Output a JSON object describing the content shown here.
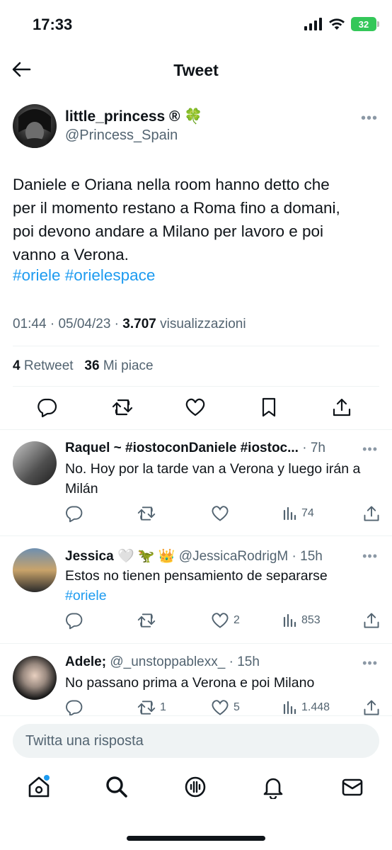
{
  "status_bar": {
    "time": "17:33",
    "battery": "32"
  },
  "header": {
    "title": "Tweet"
  },
  "tweet": {
    "author_name": "little_princess ®",
    "author_emoji": "🍀",
    "handle": "@Princess_Spain",
    "more": "•••",
    "text_lines": [
      "Daniele e Oriana nella room hanno detto che",
      "per il momento restano a Roma fino a domani,",
      "poi devono andare a Milano per lavoro e poi",
      "vanno a Verona."
    ],
    "hashtags": "#oriele #orielespace",
    "time": "01:44",
    "date": "05/04/23",
    "views_count": "3.707",
    "views_label": "visualizzazioni",
    "retweets_count": "4",
    "retweets_label": "Retweet",
    "likes_count": "36",
    "likes_label": "Mi piace"
  },
  "replies": [
    {
      "name": "Raquel ~ #iostoconDaniele #iostoc...",
      "handle": "",
      "age": "7h",
      "text": "No. Hoy por la tarde van a Verona y luego irán a Milán",
      "hashtag": "",
      "reply_count": "",
      "retweet_count": "",
      "like_count": "",
      "views": "74"
    },
    {
      "name": "Jessica",
      "emoji": "🤍 🦖 👑",
      "handle": "@JessicaRodrigM",
      "age": "15h",
      "text": "Estos no tienen pensamiento de separarse",
      "hashtag": "#oriele",
      "reply_count": "",
      "retweet_count": "",
      "like_count": "2",
      "views": "853"
    },
    {
      "name": "Adele;",
      "handle": "@_unstoppablexx_",
      "age": "15h",
      "text": "No passano prima a Verona e poi Milano",
      "hashtag": "",
      "reply_count": "",
      "retweet_count": "1",
      "like_count": "5",
      "views": "1.448"
    }
  ],
  "compose": {
    "placeholder": "Twitta una risposta"
  },
  "colors": {
    "link": "#1d9bf0",
    "secondary": "#536471",
    "battery": "#34c759"
  }
}
